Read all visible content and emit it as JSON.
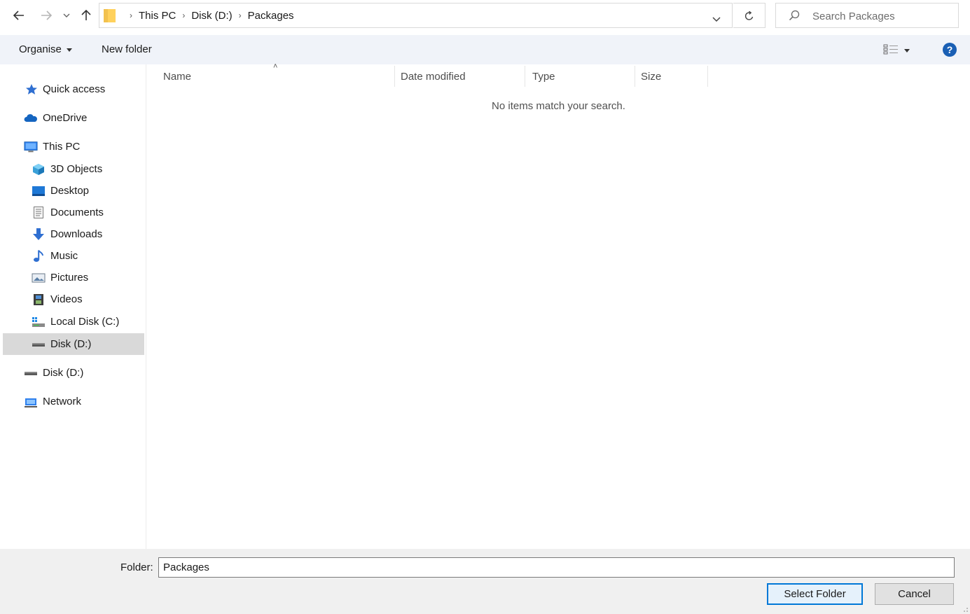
{
  "address": {
    "breadcrumbs": [
      "This PC",
      "Disk (D:)",
      "Packages"
    ]
  },
  "search": {
    "placeholder": "Search Packages"
  },
  "toolbar": {
    "organise_label": "Organise",
    "new_folder_label": "New folder"
  },
  "nav_pane": {
    "quick_access": "Quick access",
    "onedrive": "OneDrive",
    "this_pc": "This PC",
    "this_pc_children": [
      "3D Objects",
      "Desktop",
      "Documents",
      "Downloads",
      "Music",
      "Pictures",
      "Videos",
      "Local Disk (C:)",
      "Disk (D:)"
    ],
    "disk_d": "Disk (D:)",
    "network": "Network",
    "selected": "Disk (D:)"
  },
  "columns": [
    "Name",
    "Date modified",
    "Type",
    "Size"
  ],
  "empty_message": "No items match your search.",
  "footer": {
    "folder_label": "Folder:",
    "folder_value": "Packages",
    "select_label": "Select Folder",
    "cancel_label": "Cancel"
  },
  "colors": {
    "accent": "#0078d7",
    "help": "#1a5fb4",
    "folder": "#ffd15c"
  },
  "icons": [
    "back-icon",
    "forward-icon",
    "recent-dropdown-icon",
    "up-icon",
    "folder-icon",
    "refresh-icon",
    "search-icon",
    "view-icon",
    "help-icon"
  ]
}
